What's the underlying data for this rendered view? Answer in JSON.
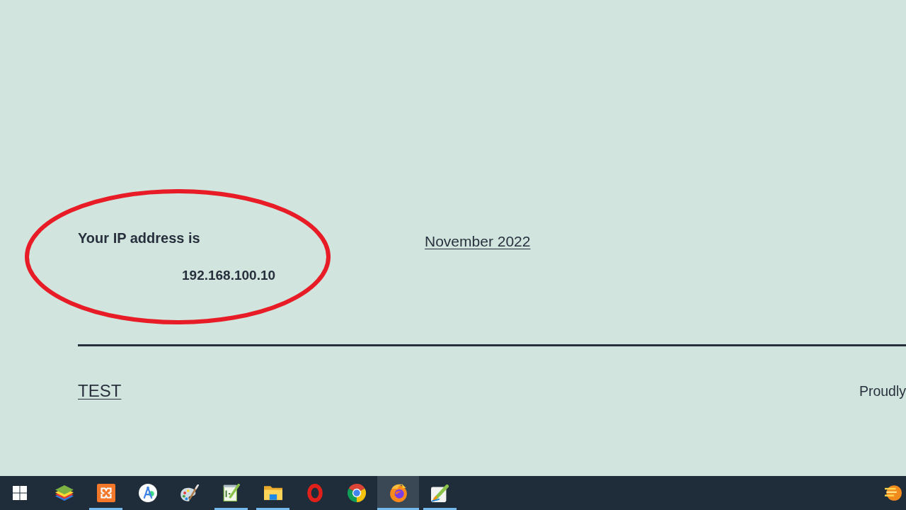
{
  "ip_widget": {
    "title": "Your IP address is",
    "ip_address": "192.168.100.10"
  },
  "annotation": {
    "kind": "ellipse"
  },
  "archive_link": "November 2022",
  "footer": {
    "site_title": "TEST",
    "credit": "Proudly"
  },
  "taskbar": {
    "apps": [
      {
        "kind": "layers",
        "running": false,
        "selected": false
      },
      {
        "kind": "tile",
        "running": true,
        "selected": false
      },
      {
        "kind": "compass",
        "running": false,
        "selected": false
      },
      {
        "kind": "palette",
        "running": false,
        "selected": false
      },
      {
        "kind": "notepad",
        "running": true,
        "selected": false
      },
      {
        "kind": "folder",
        "running": true,
        "selected": false
      },
      {
        "kind": "ring",
        "running": false,
        "selected": false
      },
      {
        "kind": "wheel",
        "running": false,
        "selected": false
      },
      {
        "kind": "globe",
        "running": true,
        "selected": true
      },
      {
        "kind": "pen",
        "running": true,
        "selected": false
      }
    ],
    "tray_icons": [
      {
        "kind": "sunset"
      }
    ]
  }
}
